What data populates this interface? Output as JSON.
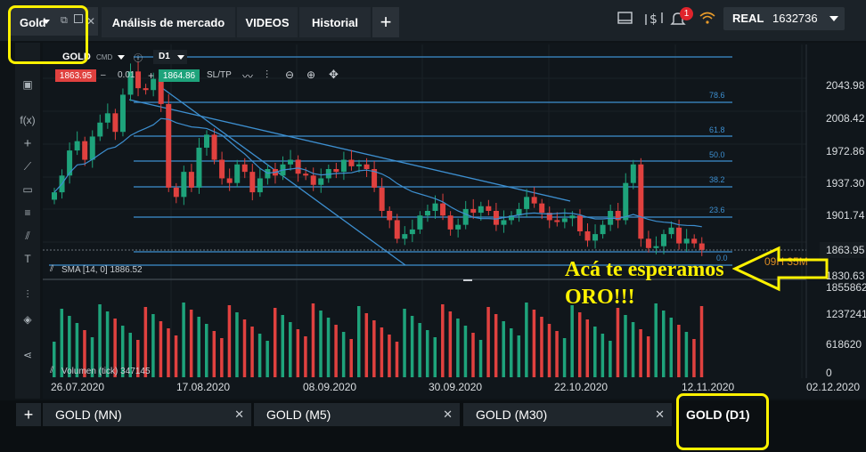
{
  "top_bar": {
    "symbol": "Gold",
    "tabs": [
      "Análisis de mercado",
      "VIDEOS",
      "Historial"
    ],
    "notification_count": "1",
    "account_type": "REAL",
    "account_value": "1632736"
  },
  "chart_header": {
    "instrument": "GOLD",
    "cmd": "CMD",
    "timeframe": "D1",
    "sell_price": "1863.95",
    "volume": "0.01",
    "buy_price": "1864.86",
    "sltp": "SL/TP",
    "minus": "–",
    "plus": "+"
  },
  "indicators": {
    "sma": "SMA [14, 0] 1886.52",
    "volume": "Volumen (tick) 347145"
  },
  "fib_levels": [
    "78.6",
    "61.8",
    "50.0",
    "38.2",
    "23.6",
    "0.0"
  ],
  "price_axis": [
    "2043.98",
    "2008.42",
    "1972.86",
    "1937.30",
    "1901.74",
    "1863.95",
    "1830.63",
    "1855862",
    "1237241",
    "618620",
    "0"
  ],
  "countdown": "09H 35M",
  "date_axis": [
    "26.07.2020",
    "17.08.2020",
    "08.09.2020",
    "30.09.2020",
    "22.10.2020",
    "12.11.2020",
    "02.12.2020"
  ],
  "bottom_tabs": [
    "GOLD (MN)",
    "GOLD (M5)",
    "GOLD (M30)",
    "GOLD (D1)"
  ],
  "annotation": {
    "line1": "Acá te esperamos",
    "line2": "ORO!!!"
  },
  "colors": {
    "bull": "#1ea37b",
    "bear": "#e0413f",
    "fib_line": "#3d8fd0",
    "highlight": "#fff200"
  }
}
